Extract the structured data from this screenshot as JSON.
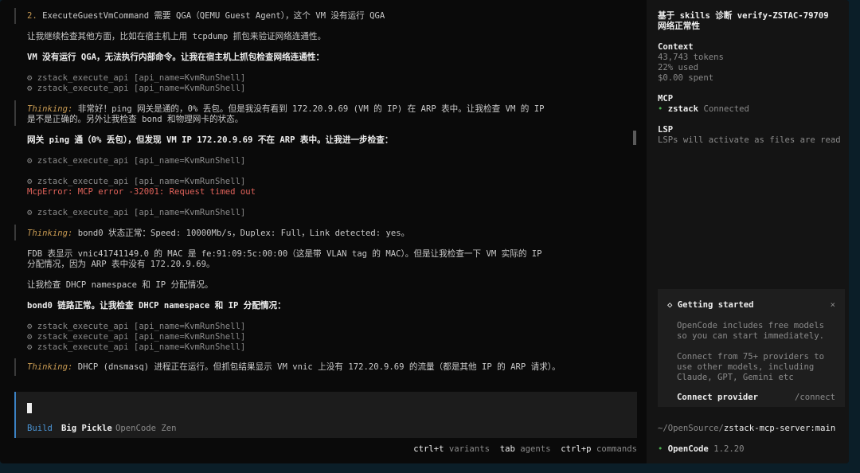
{
  "log": {
    "l1_num": "2.",
    "l1_text": " ExecuteGuestVmCommand 需要 QGA（QEMU Guest Agent），这个 VM 没有运行 QGA",
    "l2": "让我继续检查其他方面，比如在宿主机上用 tcpdump 抓包来验证网络连通性。",
    "l3": "VM 没有运行 QGA，无法执行内部命令。让我在宿主机上抓包检查网络连通性：",
    "tool_a1": "⚙ zstack_execute_api [api_name=KvmRunShell]",
    "tool_a2": "⚙ zstack_execute_api [api_name=KvmRunShell]",
    "think1_label": "Thinking:",
    "think1_text": " 非常好！ping 网关是通的，0% 丢包。但是我没有看到 172.20.9.69 (VM 的 IP) 在 ARP 表中。让我检查 VM 的 IP",
    "think1_text2": "是不是正确的。另外让我检查 bond 和物理网卡的状态。",
    "l4": "网关 ping 通（0% 丢包），但发现 VM IP 172.20.9.69 不在 ARP 表中。让我进一步检查：",
    "tool_b1": "⚙ zstack_execute_api [api_name=KvmRunShell]",
    "tool_b2": "⚙ zstack_execute_api [api_name=KvmRunShell]",
    "error": "McpError: MCP error -32001: Request timed out",
    "tool_b3": "⚙ zstack_execute_api [api_name=KvmRunShell]",
    "think2_label": "Thinking:",
    "think2_text": " bond0 状态正常：Speed: 10000Mb/s，Duplex: Full，Link detected: yes。",
    "fdb1": "FDB 表显示 vnic41741149.0 的 MAC 是 fe:91:09:5c:00:00（这是带 VLAN tag 的 MAC）。但是让我检查一下 VM 实际的 IP",
    "fdb2": "分配情况，因为 ARP 表中没有 172.20.9.69。",
    "l5": "让我检查 DHCP namespace 和 IP 分配情况。",
    "l6": "bond0 链路正常。让我检查 DHCP namespace 和 IP 分配情况：",
    "tool_c1": "⚙ zstack_execute_api [api_name=KvmRunShell]",
    "tool_c2": "⚙ zstack_execute_api [api_name=KvmRunShell]",
    "tool_c3": "⚙ zstack_execute_api [api_name=KvmRunShell]",
    "think3_label": "Thinking:",
    "think3_text": " DHCP (dnsmasq) 进程正在运行。但抓包结果显示 VM vnic 上没有 172.20.9.69 的流量（都是其他 IP 的 ARP 请求）。"
  },
  "input": {
    "mode": "Build",
    "model": "Big Pickle",
    "provider": "OpenCode Zen"
  },
  "hints": {
    "k1": "ctrl+t",
    "v1": "variants",
    "k2": "tab",
    "v2": "agents",
    "k3": "ctrl+p",
    "v3": "commands"
  },
  "sidebar": {
    "title1": "基于 skills 诊断 verify-ZSTAC-79709",
    "title2": "网络正常性",
    "context_h": "Context",
    "tokens": "43,743 tokens",
    "used": "22% used",
    "spent": "$0.00 spent",
    "mcp_h": "MCP",
    "mcp_dot": "•",
    "mcp_name": "zstack",
    "mcp_status": "Connected",
    "lsp_h": "LSP",
    "lsp_text": "LSPs will activate as files are read",
    "path_prefix": "~/OpenSource/",
    "path_branch": "zstack-mcp-server:main",
    "app_dot": "•",
    "app_name": "OpenCode",
    "app_version": "1.2.20"
  },
  "card": {
    "icon": "◇",
    "title": "Getting started",
    "close": "×",
    "p1": "OpenCode includes free models",
    "p2": "so you can start immediately.",
    "p3": "Connect from 75+ providers to",
    "p4": "use other models, including",
    "p5": "Claude, GPT, Gemini etc",
    "btn": "Connect provider",
    "cmd": "/connect"
  }
}
